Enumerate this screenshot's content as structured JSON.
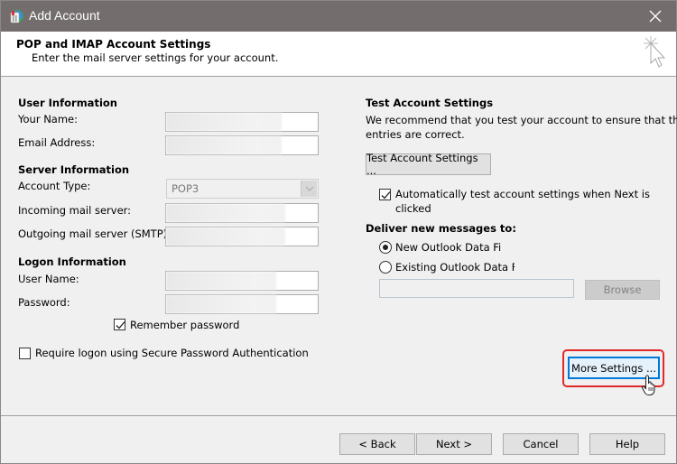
{
  "window": {
    "title": "Add Account",
    "close_icon": "close-icon",
    "app_icon": "outlook-account-icon"
  },
  "header": {
    "title": "POP and IMAP Account Settings",
    "subtitle": "Enter the mail server settings for your account.",
    "icon": "wizard-cursor-sparkle-icon"
  },
  "user_info": {
    "heading": "User Information",
    "your_name_label": "Your Name:",
    "your_name_value": "",
    "email_label": "Email Address:",
    "email_value": ""
  },
  "server_info": {
    "heading": "Server Information",
    "account_type_label": "Account Type:",
    "account_type_value": "POP3",
    "incoming_label": "Incoming mail server:",
    "incoming_value": "",
    "outgoing_label": "Outgoing mail server (SMTP):",
    "outgoing_value": ""
  },
  "logon_info": {
    "heading": "Logon Information",
    "username_label": "User Name:",
    "username_value": "",
    "password_label": "Password:",
    "password_value": "",
    "remember_password_label": "Remember password",
    "remember_password_checked": true,
    "spa_label": "Require logon using Secure Password Authentication",
    "spa_checked": false
  },
  "test_settings": {
    "heading": "Test Account Settings",
    "description": "We recommend that you test your account to ensure that the entries are correct.",
    "desc_line1": "We recommend that you test your account to ensure that the",
    "desc_line2": "entries are correct.",
    "test_button": "Test Account Settings ...",
    "auto_test_line1": "Automatically test account settings when Next is",
    "auto_test_line2": "clicked",
    "auto_test_checked": true
  },
  "deliver": {
    "heading": "Deliver new messages to:",
    "options": [
      {
        "label": "New Outlook Data File",
        "selected": true
      },
      {
        "label": "Existing Outlook Data File",
        "selected": false
      }
    ],
    "existing_file_path": "",
    "browse_button": "Browse"
  },
  "more_settings_button": "More Settings ...",
  "footer": {
    "back": "< Back",
    "next": "Next >",
    "cancel": "Cancel",
    "help": "Help"
  },
  "colors": {
    "titlebar": "#736e6d",
    "highlight": "#e32828",
    "focus": "#0078d7"
  }
}
